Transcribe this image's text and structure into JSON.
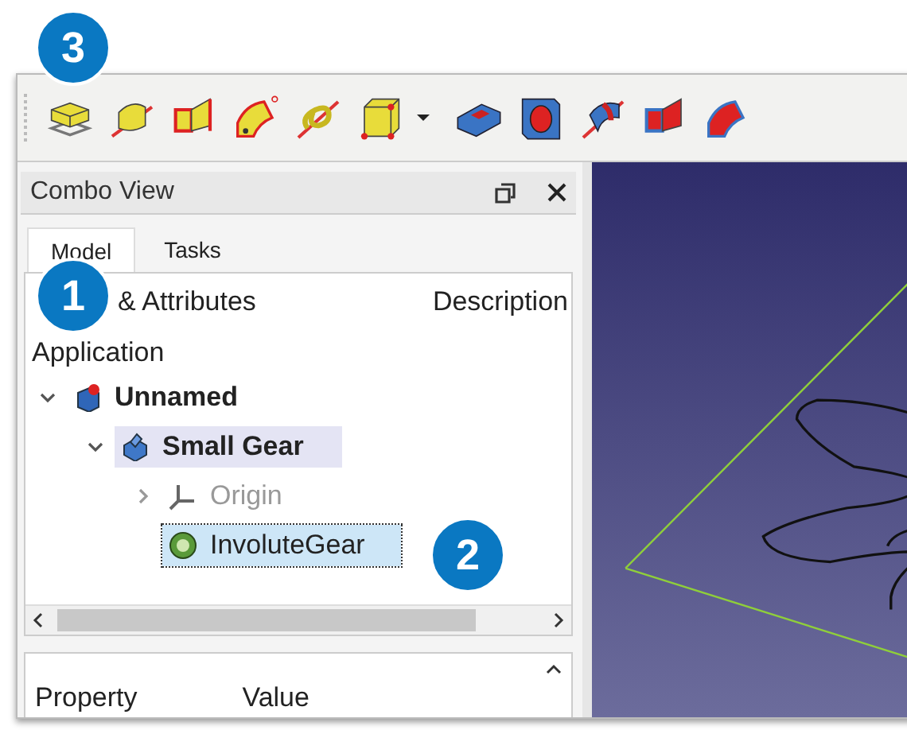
{
  "combo_view": {
    "title": "Combo View",
    "tabs": [
      {
        "label": "Model",
        "selected": true
      },
      {
        "label": "Tasks",
        "selected": false
      }
    ]
  },
  "tree": {
    "columns": [
      "& Attributes",
      "Description"
    ],
    "group": "Application",
    "items": [
      {
        "label": "Unnamed",
        "kind": "document",
        "expanded": true,
        "selected": false,
        "children": [
          {
            "label": "Small Gear",
            "kind": "body",
            "expanded": true,
            "selected": false,
            "children": [
              {
                "label": "Origin",
                "kind": "origin",
                "expanded": false,
                "selected": false
              },
              {
                "label": "InvoluteGear",
                "kind": "feature",
                "selected": true
              }
            ]
          }
        ]
      }
    ]
  },
  "property_panel": {
    "columns": [
      "Property",
      "Value"
    ]
  },
  "callouts": [
    "3",
    "1",
    "2"
  ]
}
